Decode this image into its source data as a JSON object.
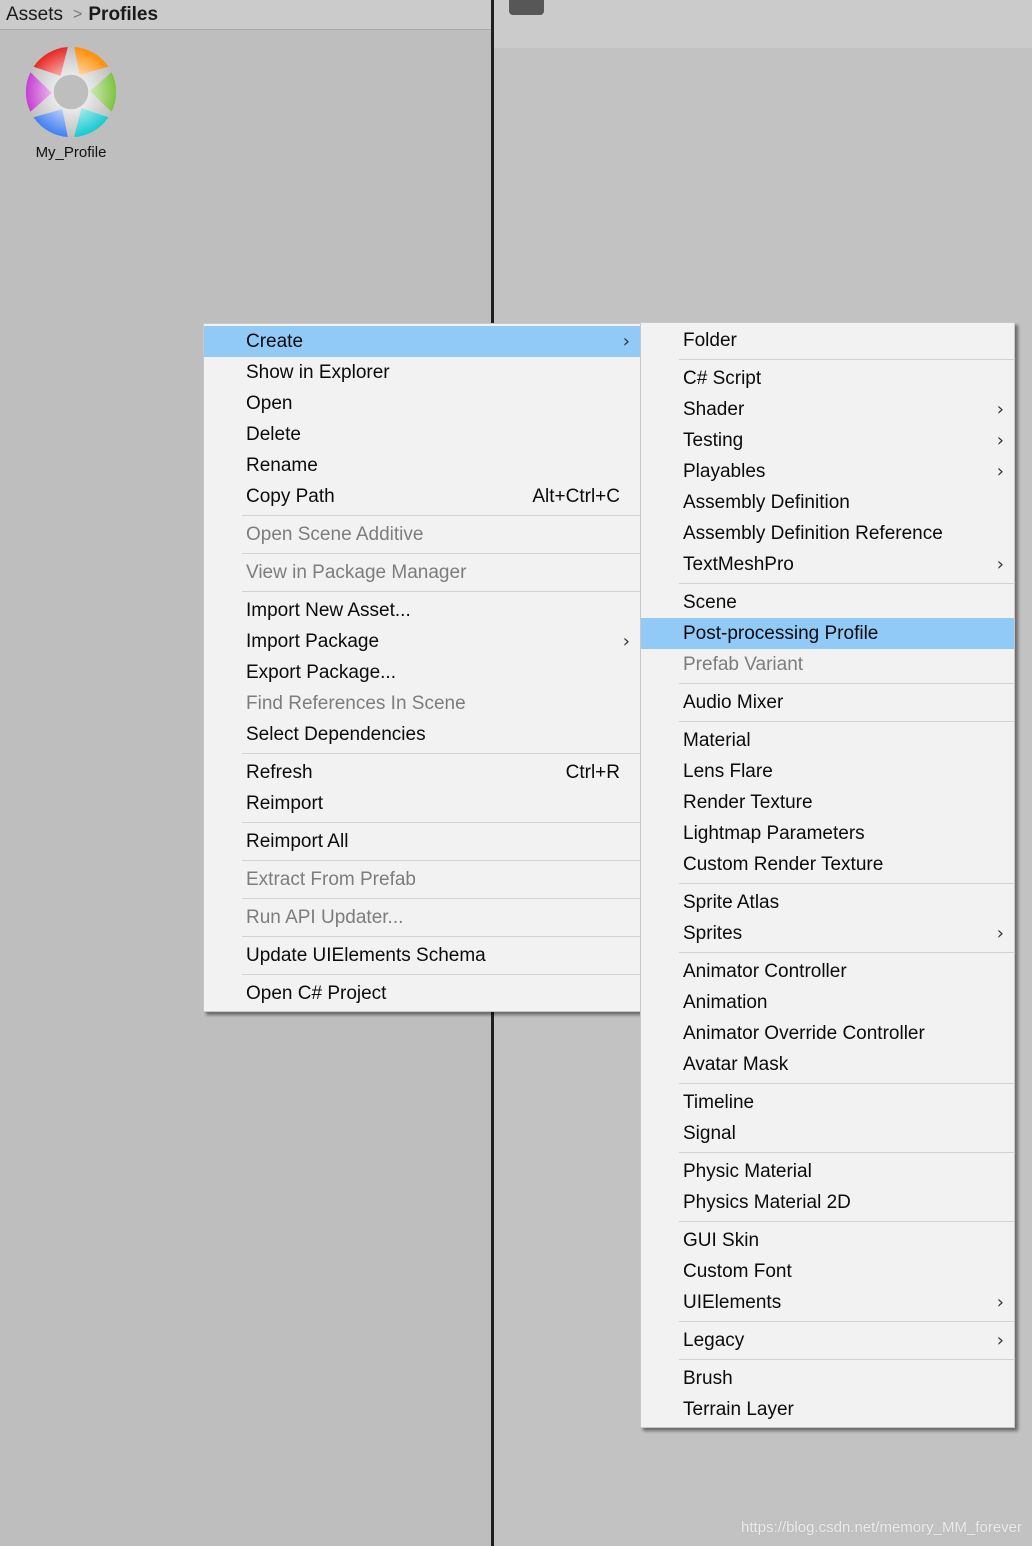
{
  "breadcrumb": {
    "root": "Assets",
    "separator": ">",
    "current": "Profiles"
  },
  "assets": [
    {
      "name": "My_Profile",
      "icon": "post-processing-profile-icon"
    }
  ],
  "colors": {
    "highlight": "#91c9f7",
    "menu_bg": "#f2f2f2",
    "disabled_text": "#7d7d7d",
    "pane_bg": "#bebebe"
  },
  "context_menu": {
    "groups": [
      [
        {
          "label": "Create",
          "submenu": true,
          "highlighted": true
        },
        {
          "label": "Show in Explorer"
        },
        {
          "label": "Open"
        },
        {
          "label": "Delete"
        },
        {
          "label": "Rename"
        },
        {
          "label": "Copy Path",
          "shortcut": "Alt+Ctrl+C"
        }
      ],
      [
        {
          "label": "Open Scene Additive",
          "disabled": true
        }
      ],
      [
        {
          "label": "View in Package Manager",
          "disabled": true
        }
      ],
      [
        {
          "label": "Import New Asset..."
        },
        {
          "label": "Import Package",
          "submenu": true
        },
        {
          "label": "Export Package..."
        },
        {
          "label": "Find References In Scene",
          "disabled": true
        },
        {
          "label": "Select Dependencies"
        }
      ],
      [
        {
          "label": "Refresh",
          "shortcut": "Ctrl+R"
        },
        {
          "label": "Reimport"
        }
      ],
      [
        {
          "label": "Reimport All"
        }
      ],
      [
        {
          "label": "Extract From Prefab",
          "disabled": true
        }
      ],
      [
        {
          "label": "Run API Updater...",
          "disabled": true
        }
      ],
      [
        {
          "label": "Update UIElements Schema"
        }
      ],
      [
        {
          "label": "Open C# Project"
        }
      ]
    ]
  },
  "create_submenu": {
    "groups": [
      [
        {
          "label": "Folder"
        }
      ],
      [
        {
          "label": "C# Script"
        },
        {
          "label": "Shader",
          "submenu": true
        },
        {
          "label": "Testing",
          "submenu": true
        },
        {
          "label": "Playables",
          "submenu": true
        },
        {
          "label": "Assembly Definition"
        },
        {
          "label": "Assembly Definition Reference"
        },
        {
          "label": "TextMeshPro",
          "submenu": true
        }
      ],
      [
        {
          "label": "Scene"
        },
        {
          "label": "Post-processing Profile",
          "highlighted": true
        },
        {
          "label": "Prefab Variant",
          "disabled": true
        }
      ],
      [
        {
          "label": "Audio Mixer"
        }
      ],
      [
        {
          "label": "Material"
        },
        {
          "label": "Lens Flare"
        },
        {
          "label": "Render Texture"
        },
        {
          "label": "Lightmap Parameters"
        },
        {
          "label": "Custom Render Texture"
        }
      ],
      [
        {
          "label": "Sprite Atlas"
        },
        {
          "label": "Sprites",
          "submenu": true
        }
      ],
      [
        {
          "label": "Animator Controller"
        },
        {
          "label": "Animation"
        },
        {
          "label": "Animator Override Controller"
        },
        {
          "label": "Avatar Mask"
        }
      ],
      [
        {
          "label": "Timeline"
        },
        {
          "label": "Signal"
        }
      ],
      [
        {
          "label": "Physic Material"
        },
        {
          "label": "Physics Material 2D"
        }
      ],
      [
        {
          "label": "GUI Skin"
        },
        {
          "label": "Custom Font"
        },
        {
          "label": "UIElements",
          "submenu": true
        }
      ],
      [
        {
          "label": "Legacy",
          "submenu": true
        }
      ],
      [
        {
          "label": "Brush"
        },
        {
          "label": "Terrain Layer"
        }
      ]
    ]
  },
  "watermark": "https://blog.csdn.net/memory_MM_forever"
}
